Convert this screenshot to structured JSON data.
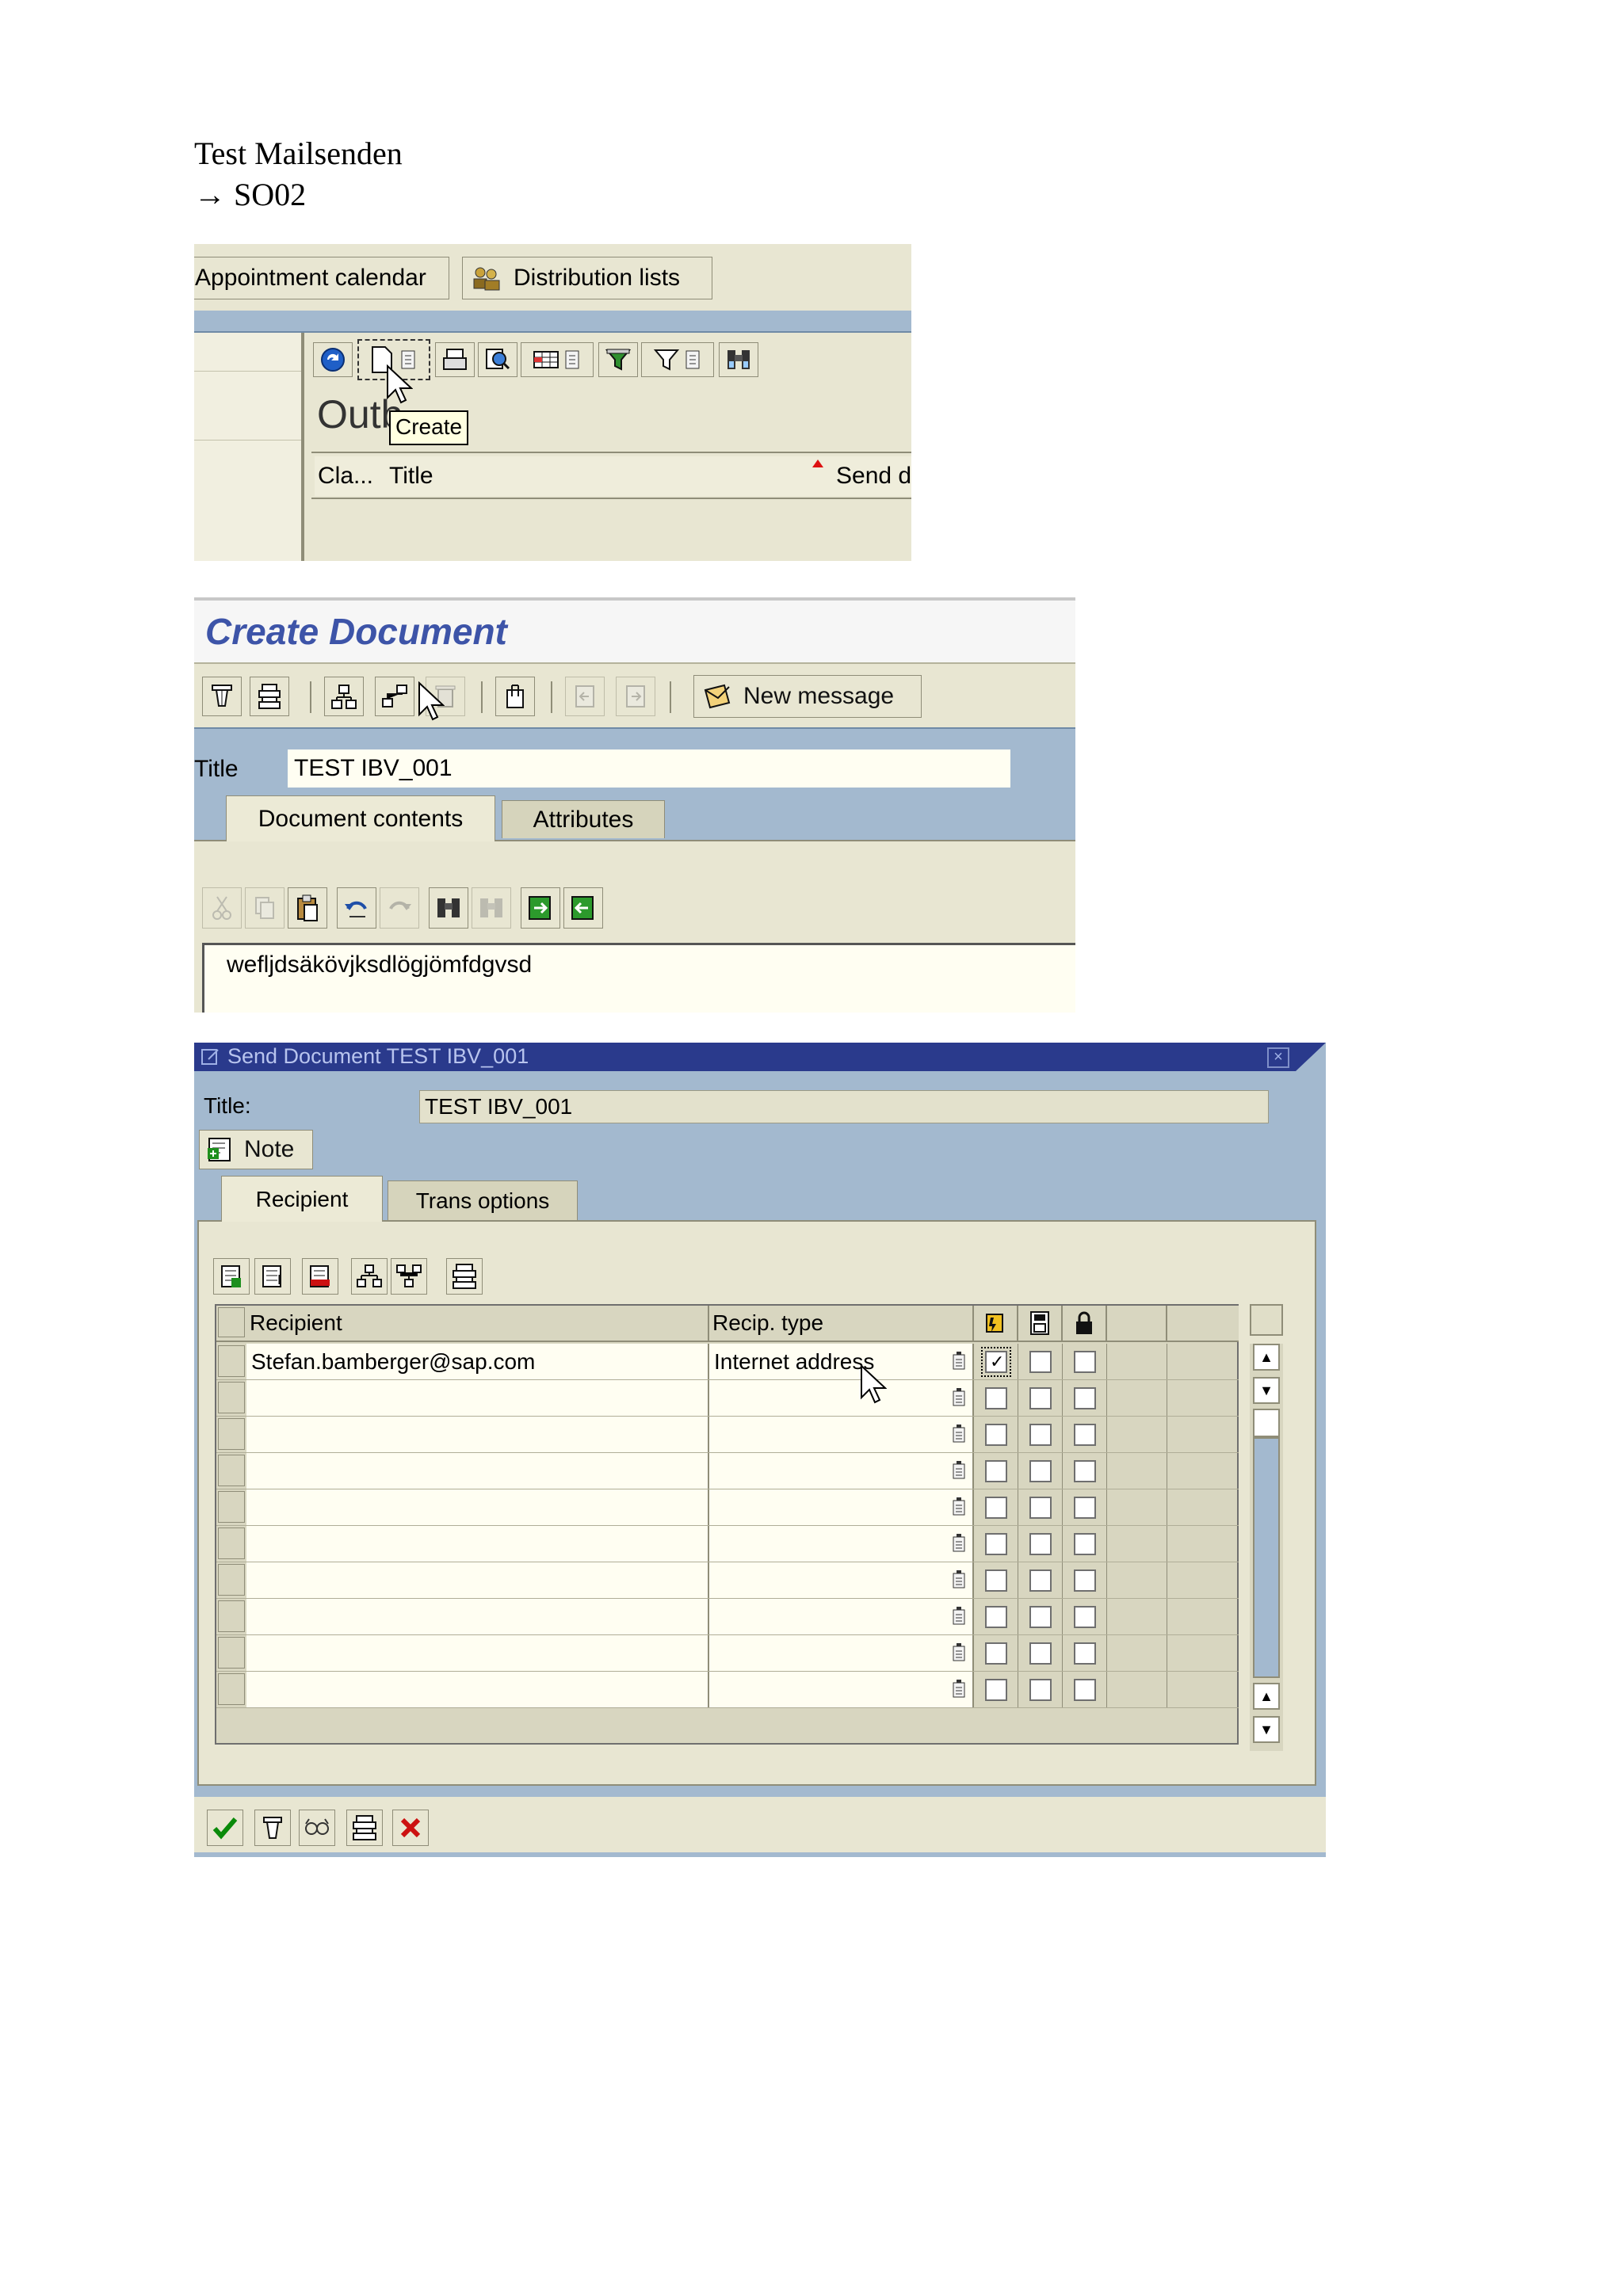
{
  "doc": {
    "heading": "Test Mailsenden",
    "transaction": "SO02"
  },
  "shot1": {
    "tabs": [
      {
        "label": "Appointment calendar"
      },
      {
        "label": "Distribution lists"
      }
    ],
    "section_title_partial": "Outb",
    "tooltip": "Create",
    "columns": [
      {
        "label": "Cla..."
      },
      {
        "label": "Title"
      },
      {
        "label": "Send d"
      }
    ]
  },
  "shot2": {
    "title": "Create Document",
    "new_message_label": "New message",
    "title_label": "Title",
    "title_value": "TEST IBV_001",
    "tabs": [
      {
        "label": "Document contents"
      },
      {
        "label": "Attributes"
      }
    ],
    "body_text": "wefljdsäkövjksdlögjömfdgvsd"
  },
  "shot3": {
    "window_title": "Send Document TEST IBV_001",
    "title_label": "Title:",
    "title_value": "TEST IBV_001",
    "note_label": "Note",
    "tabs": [
      {
        "label": "Recipient"
      },
      {
        "label": "Trans options"
      }
    ],
    "columns": {
      "recipient": "Recipient",
      "recip_type": "Recip. type"
    },
    "rows": [
      {
        "recipient": "Stefan.bamberger@sap.com",
        "type": "Internet address",
        "express": true,
        "copy": false,
        "blind": false
      },
      {
        "recipient": "",
        "type": "",
        "express": false,
        "copy": false,
        "blind": false
      },
      {
        "recipient": "",
        "type": "",
        "express": false,
        "copy": false,
        "blind": false
      },
      {
        "recipient": "",
        "type": "",
        "express": false,
        "copy": false,
        "blind": false
      },
      {
        "recipient": "",
        "type": "",
        "express": false,
        "copy": false,
        "blind": false
      },
      {
        "recipient": "",
        "type": "",
        "express": false,
        "copy": false,
        "blind": false
      },
      {
        "recipient": "",
        "type": "",
        "express": false,
        "copy": false,
        "blind": false
      },
      {
        "recipient": "",
        "type": "",
        "express": false,
        "copy": false,
        "blind": false
      },
      {
        "recipient": "",
        "type": "",
        "express": false,
        "copy": false,
        "blind": false
      },
      {
        "recipient": "",
        "type": "",
        "express": false,
        "copy": false,
        "blind": false
      }
    ]
  },
  "colors": {
    "sap_panel": "#e8e6d2",
    "sap_blue_bar": "#a3b9cf",
    "dialog_title_bar": "#2a3a8c",
    "title_blue_text": "#3d54a8",
    "field_bg": "#fffef2",
    "delete_red": "#cc1111",
    "check_green": "#0a8a0a"
  }
}
